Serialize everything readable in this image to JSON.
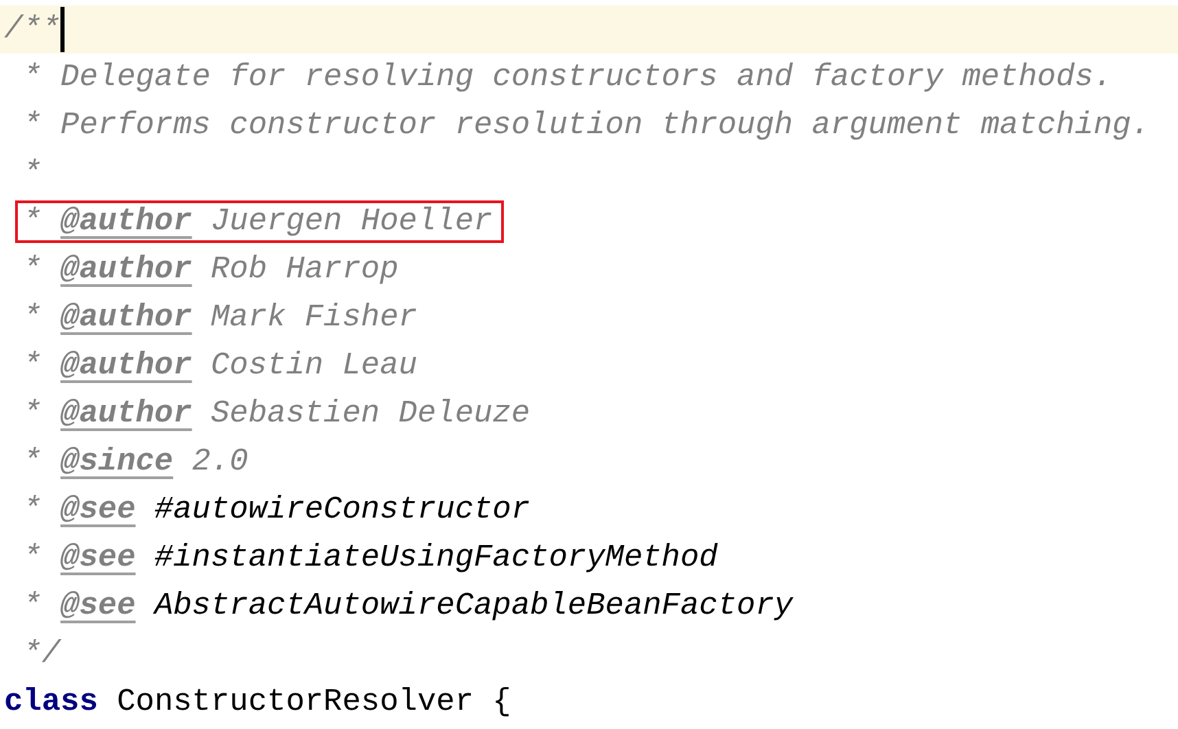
{
  "editor": {
    "lines": [
      {
        "kind": "comment_open",
        "text": "/**",
        "current": true,
        "boxed": false
      },
      {
        "kind": "comment",
        "text": "* Delegate for resolving constructors and factory methods.",
        "current": false,
        "boxed": false
      },
      {
        "kind": "comment",
        "text": "* Performs constructor resolution through argument matching.",
        "current": false,
        "boxed": false
      },
      {
        "kind": "comment",
        "text": "*",
        "current": false,
        "boxed": false
      },
      {
        "kind": "tag",
        "star": "*",
        "tag": "@author",
        "value": "Juergen Hoeller",
        "ref": false,
        "current": false,
        "boxed": true
      },
      {
        "kind": "tag",
        "star": "*",
        "tag": "@author",
        "value": "Rob Harrop",
        "ref": false,
        "current": false,
        "boxed": false
      },
      {
        "kind": "tag",
        "star": "*",
        "tag": "@author",
        "value": "Mark Fisher",
        "ref": false,
        "current": false,
        "boxed": false
      },
      {
        "kind": "tag",
        "star": "*",
        "tag": "@author",
        "value": "Costin Leau",
        "ref": false,
        "current": false,
        "boxed": false
      },
      {
        "kind": "tag",
        "star": "*",
        "tag": "@author",
        "value": "Sebastien Deleuze",
        "ref": false,
        "current": false,
        "boxed": false
      },
      {
        "kind": "tag",
        "star": "*",
        "tag": "@since",
        "value": "2.0",
        "ref": false,
        "current": false,
        "boxed": false
      },
      {
        "kind": "tag",
        "star": "*",
        "tag": "@see",
        "value": "#autowireConstructor",
        "ref": true,
        "current": false,
        "boxed": false
      },
      {
        "kind": "tag",
        "star": "*",
        "tag": "@see",
        "value": "#instantiateUsingFactoryMethod",
        "ref": true,
        "current": false,
        "boxed": false
      },
      {
        "kind": "tag",
        "star": "*",
        "tag": "@see",
        "value": "AbstractAutowireCapableBeanFactory",
        "ref": true,
        "current": false,
        "boxed": false
      },
      {
        "kind": "comment_close",
        "text": "*/",
        "current": false,
        "boxed": false
      },
      {
        "kind": "code",
        "keyword": "class",
        "text": "ConstructorResolver {",
        "current": false,
        "boxed": false
      }
    ]
  }
}
